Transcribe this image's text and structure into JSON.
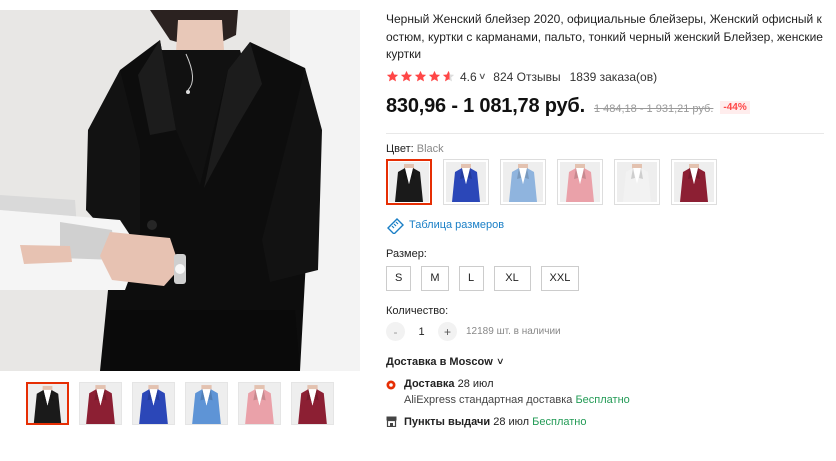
{
  "product": {
    "title": "Черный Женский блейзер 2020, официальные блейзеры, Женский офисный костюм, куртки с карманами, пальто, тонкий черный женский Блейзер, женские куртки"
  },
  "rating": {
    "stars": 4.6,
    "value": "4.6",
    "reviews": "824 Отзывы",
    "orders": "1839 заказа(ов)"
  },
  "price": {
    "current": "830,96 - 1 081,78 руб.",
    "original": "1 484,18 - 1 931,21 руб.",
    "discount": "-44%"
  },
  "color": {
    "label": "Цвет:",
    "selected": "Black",
    "swatches": [
      {
        "name": "black",
        "color": "#1a1a1a"
      },
      {
        "name": "royal-blue",
        "color": "#2b47b8"
      },
      {
        "name": "light-blue",
        "color": "#8fb4de"
      },
      {
        "name": "pink",
        "color": "#eaa1a9"
      },
      {
        "name": "white",
        "color": "#f2f2f2"
      },
      {
        "name": "burgundy",
        "color": "#8c1f33"
      }
    ]
  },
  "size_table": {
    "label": "Таблица размеров"
  },
  "size": {
    "label": "Размер:",
    "options": [
      "S",
      "M",
      "L",
      "XL",
      "XXL"
    ]
  },
  "quantity": {
    "label": "Количество:",
    "minus": "-",
    "plus": "+",
    "value": "1",
    "stock": "12189 шт. в наличии"
  },
  "delivery": {
    "header": "Доставка в Moscow",
    "title": "Доставка",
    "date": "28 июл",
    "carrier": "AliExpress стандартная доставка",
    "free": "Бесплатно",
    "pickup_title": "Пункты выдачи",
    "pickup_date": "28 июл",
    "pickup_free": "Бесплатно"
  },
  "gallery": {
    "thumbs": [
      {
        "name": "black",
        "color": "#1a1a1a"
      },
      {
        "name": "burgundy",
        "color": "#8c1f33"
      },
      {
        "name": "royal-blue",
        "color": "#2b47b8"
      },
      {
        "name": "light-blue",
        "color": "#5e94d6"
      },
      {
        "name": "pink",
        "color": "#eaa1a9"
      },
      {
        "name": "burgundy-2",
        "color": "#8c1f33"
      }
    ]
  },
  "colors": {
    "accent": "#e62e04",
    "star": "#ff4747",
    "link": "#1a7fc6",
    "free": "#239b56"
  }
}
